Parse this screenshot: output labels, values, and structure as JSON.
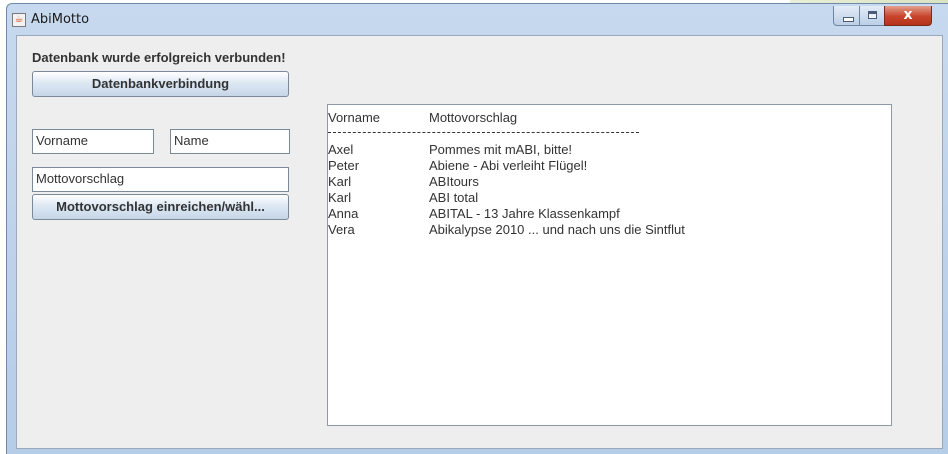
{
  "window": {
    "title": "AbiMotto",
    "close_label": "x"
  },
  "status": {
    "message": "Datenbank wurde erfolgreich verbunden!"
  },
  "buttons": {
    "connect_label": "Datenbankverbindung",
    "submit_label": "Mottovorschlag einreichen/wähl..."
  },
  "fields": {
    "vorname": "Vorname",
    "name": "Name",
    "motto": "Mottovorschlag"
  },
  "output": {
    "headers": [
      "Vorname",
      "Mottovorschlag"
    ],
    "separator": "---------------------------------------------------------------------------------------------",
    "rows": [
      {
        "vorname": "Axel",
        "motto": "Pommes mit mABI, bitte!"
      },
      {
        "vorname": "Peter",
        "motto": "Abiene - Abi verleiht Flügel!"
      },
      {
        "vorname": "Karl",
        "motto": "ABItours"
      },
      {
        "vorname": "Karl",
        "motto": "ABI total"
      },
      {
        "vorname": "Anna",
        "motto": "ABITAL - 13 Jahre Klassenkampf"
      },
      {
        "vorname": "Vera",
        "motto": "Abikalypse 2010 ... und nach uns die Sintflut"
      }
    ]
  },
  "colors": {
    "close_button": "#c8432b",
    "title_bar": "#b6cde8",
    "panel_background": "#eeeeee"
  }
}
